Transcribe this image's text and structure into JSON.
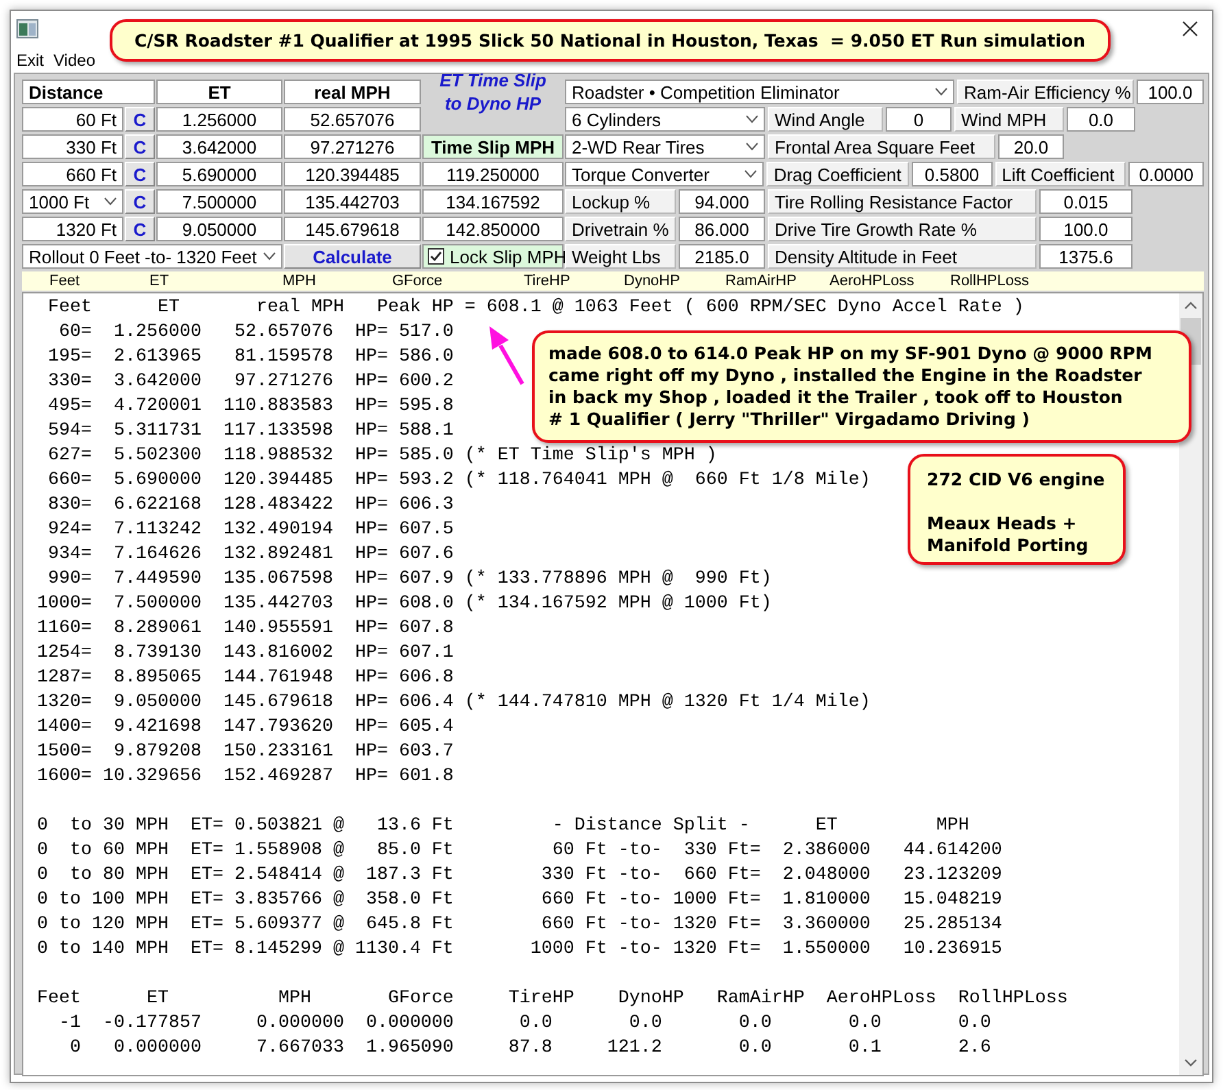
{
  "title_callout": "C/SR Roadster #1 Qualifier at 1995 Slick 50 National in Houston, Texas  = 9.050 ET Run simulation",
  "menu": [
    {
      "label": "Exit"
    },
    {
      "label": "Video"
    }
  ],
  "splits": {
    "columns": [
      "Distance",
      "ET",
      "real MPH"
    ],
    "rows": [
      {
        "kind": "label",
        "distance": "60 Ft",
        "button": "C",
        "et": "1.256000",
        "mph": "52.657076"
      },
      {
        "kind": "label",
        "distance": "330 Ft",
        "button": "C",
        "et": "3.642000",
        "mph": "97.271276"
      },
      {
        "kind": "label",
        "distance": "660 Ft",
        "button": "C",
        "et": "5.690000",
        "mph": "120.394485"
      },
      {
        "kind": "dropdown",
        "distance": "1000 Ft",
        "button": "C",
        "et": "7.500000",
        "mph": "135.442703"
      },
      {
        "kind": "label",
        "distance": "1320 Ft",
        "button": "C",
        "et": "9.050000",
        "mph": "145.679618"
      }
    ]
  },
  "time_slip": {
    "title": "ET Time Slip\nto Dyno HP",
    "label": "Time Slip MPH",
    "values": [
      "119.250000",
      "134.167592",
      "142.850000"
    ]
  },
  "rollout": "Rollout 0 Feet -to- 1320 Feet",
  "calculate": "Calculate",
  "lock_slip": {
    "label": "Lock Slip MPH",
    "checked": true
  },
  "settings": [
    [
      {
        "kind": "dropdown",
        "text": "Roadster • Competition Eliminator"
      },
      {
        "kind": "label",
        "text": "Ram-Air Efficiency %"
      },
      {
        "kind": "field",
        "text": "100.0"
      }
    ],
    [
      {
        "kind": "dropdown",
        "text": "6  Cylinders"
      },
      {
        "kind": "label",
        "text": "Wind Angle"
      },
      {
        "kind": "field",
        "text": "0"
      },
      {
        "kind": "label",
        "text": "Wind MPH"
      },
      {
        "kind": "field",
        "text": "0.0"
      }
    ],
    [
      {
        "kind": "dropdown",
        "text": "2-WD Rear Tires"
      },
      {
        "kind": "label",
        "text": "Frontal Area Square Feet"
      },
      {
        "kind": "field",
        "text": "20.0"
      }
    ],
    [
      {
        "kind": "dropdown",
        "text": "Torque Converter"
      },
      {
        "kind": "label",
        "text": "Drag Coefficient"
      },
      {
        "kind": "field",
        "text": "0.5800"
      },
      {
        "kind": "label",
        "text": "Lift Coefficient"
      },
      {
        "kind": "field",
        "text": "0.0000"
      }
    ],
    [
      {
        "kind": "label",
        "text": "Lockup %"
      },
      {
        "kind": "field",
        "text": "94.000"
      },
      {
        "kind": "label",
        "text": "Tire Rolling Resistance Factor"
      },
      {
        "kind": "field",
        "text": "0.015"
      }
    ],
    [
      {
        "kind": "label",
        "text": "Drivetrain %"
      },
      {
        "kind": "field",
        "text": "86.000"
      },
      {
        "kind": "label",
        "text": "Drive Tire Growth Rate %"
      },
      {
        "kind": "field",
        "text": "100.0"
      }
    ],
    [
      {
        "kind": "label",
        "text": "Weight Lbs"
      },
      {
        "kind": "field",
        "text": "2185.0"
      },
      {
        "kind": "label",
        "text": "Density Altitude in Feet"
      },
      {
        "kind": "field",
        "text": "1375.6"
      }
    ]
  ],
  "results_columns": [
    "Feet",
    "ET",
    "MPH",
    "GForce",
    "TireHP",
    "DynoHP",
    "RamAirHP",
    "AeroHPLoss",
    "RollHPLoss"
  ],
  "output": [
    [
      " Feet      ET       real MPH   Peak HP = 608.1 @ 1063 Feet ( 600 RPM/SEC Dyno Accel Rate )",
      "  60=  1.256000   52.657076  HP= 517.0",
      " 195=  2.613965   81.159578  HP= 586.0",
      " 330=  3.642000   97.271276  HP= 600.2",
      " 495=  4.720001  110.883583  HP= 595.8",
      " 594=  5.311731  117.133598  HP= 588.1",
      " 627=  5.502300  118.988532  HP= 585.0 (* ET Time Slip's MPH )",
      " 660=  5.690000  120.394485  HP= 593.2 (* 118.764041 MPH @  660 Ft 1/8 Mile)",
      " 830=  6.622168  128.483422  HP= 606.3",
      " 924=  7.113242  132.490194  HP= 607.5",
      " 934=  7.164626  132.892481  HP= 607.6",
      " 990=  7.449590  135.067598  HP= 607.9 (* 133.778896 MPH @  990 Ft)",
      "1000=  7.500000  135.442703  HP= 608.0 (* 134.167592 MPH @ 1000 Ft)",
      "1160=  8.289061  140.955591  HP= 607.8",
      "1254=  8.739130  143.816002  HP= 607.1",
      "1287=  8.895065  144.761948  HP= 606.8",
      "1320=  9.050000  145.679618  HP= 606.4 (* 144.747810 MPH @ 1320 Ft 1/4 Mile)",
      "1400=  9.421698  147.793620  HP= 605.4",
      "1500=  9.879208  150.233161  HP= 603.7",
      "1600= 10.329656  152.469287  HP= 601.8"
    ],
    [
      "0  to 30 MPH  ET= 0.503821 @   13.6 Ft         - Distance Split -      ET         MPH",
      "0  to 60 MPH  ET= 1.558908 @   85.0 Ft         60 Ft -to-  330 Ft=  2.386000   44.614200",
      "0  to 80 MPH  ET= 2.548414 @  187.3 Ft        330 Ft -to-  660 Ft=  2.048000   23.123209",
      "0 to 100 MPH  ET= 3.835766 @  358.0 Ft        660 Ft -to- 1000 Ft=  1.810000   15.048219",
      "0 to 120 MPH  ET= 5.609377 @  645.8 Ft        660 Ft -to- 1320 Ft=  3.360000   25.285134",
      "0 to 140 MPH  ET= 8.145299 @ 1130.4 Ft       1000 Ft -to- 1320 Ft=  1.550000   10.236915"
    ],
    [
      "Feet      ET          MPH       GForce     TireHP    DynoHP   RamAirHP  AeroHPLoss  RollHPLoss",
      "  -1  -0.177857     0.000000  0.000000      0.0       0.0       0.0       0.0       0.0",
      "   0   0.000000     7.667033  1.965090     87.8     121.2       0.0       0.1       2.6"
    ]
  ],
  "notes": [
    "made 608.0 to 614.0 Peak HP on my SF-901 Dyno @ 9000 RPM\ncame right off my Dyno , installed the Engine in the Roadster\nin back my Shop , loaded it the Trailer , took off to Houston\n# 1 Qualifier ( Jerry \"Thriller\" Virgadamo Driving )",
    "272 CID V6 engine\n\nMeaux Heads +\nManifold Porting"
  ]
}
